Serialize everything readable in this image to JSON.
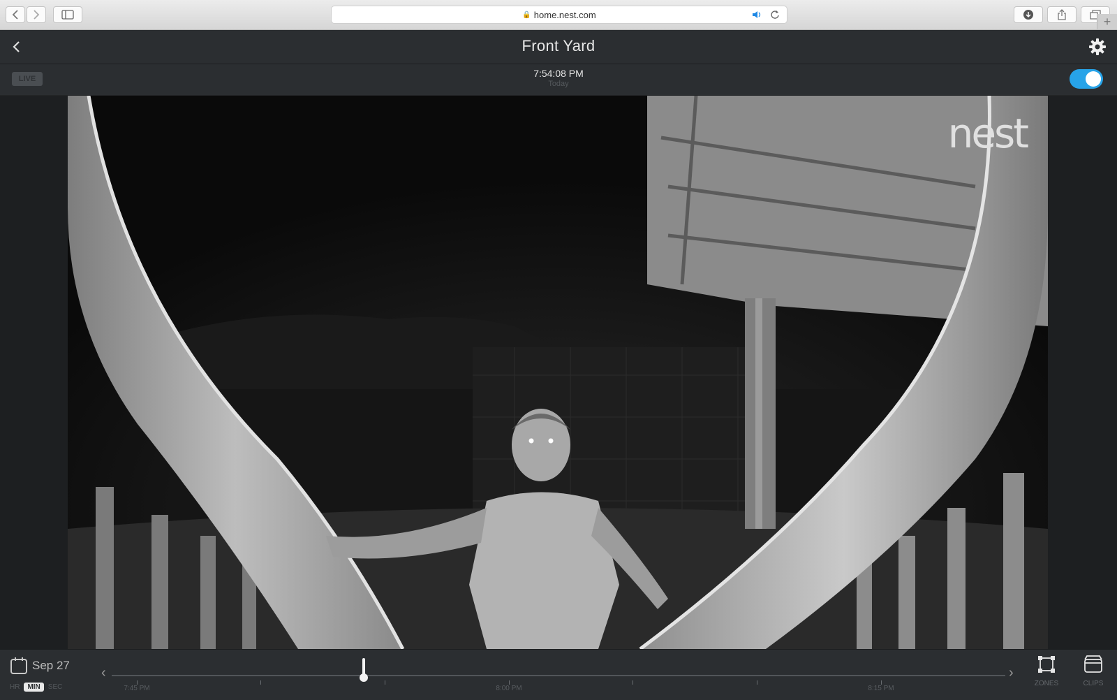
{
  "browser": {
    "url": "home.nest.com"
  },
  "header": {
    "title": "Front Yard"
  },
  "subbar": {
    "live_label": "LIVE",
    "time": "7:54:08 PM",
    "day": "Today",
    "camera_on": true
  },
  "video": {
    "watermark": "nest"
  },
  "bottom": {
    "date": "Sep 27",
    "scale": {
      "hr": "HR",
      "min": "MIN",
      "sec": "SEC"
    },
    "timeline_labels": [
      "7:45 PM",
      "8:00 PM",
      "8:15 PM"
    ],
    "tools": {
      "zones": "ZONES",
      "clips": "CLIPS"
    }
  },
  "colors": {
    "toggle_accent": "#27a3e8",
    "app_background": "#2b2e31"
  },
  "icons": [
    "back-arrow-icon",
    "forward-arrow-icon",
    "sidebar-icon",
    "lock-icon",
    "speaker-icon",
    "reload-icon",
    "download-icon",
    "share-icon",
    "tabs-icon",
    "gear-icon",
    "calendar-icon",
    "zones-icon",
    "clips-icon"
  ]
}
